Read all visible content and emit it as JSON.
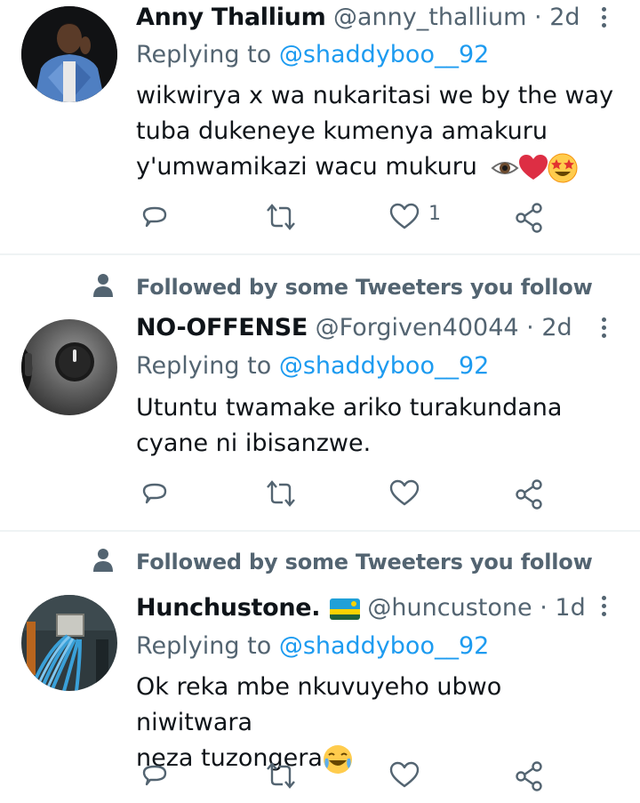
{
  "tweets": [
    {
      "name": "Anny Thallium",
      "handle": "@anny_thallium",
      "separator": "·",
      "time": "2d",
      "replying_prefix": "Replying to",
      "replying_handle": "@shaddyboo__92",
      "lines": [
        "wikwirya x wa nukaritasi we by the way",
        "tuba dukeneye kumenya amakuru",
        "y'umwamikazi wacu mukuru"
      ],
      "like_count": "1"
    },
    {
      "social_context": "Followed by some Tweeters you follow",
      "name": "NO-OFFENSE",
      "handle": "@Forgiven40044",
      "separator": "·",
      "time": "2d",
      "replying_prefix": "Replying to",
      "replying_handle": "@shaddyboo__92",
      "lines": [
        "Utuntu twamake ariko turakundana",
        "cyane ni ibisanzwe."
      ]
    },
    {
      "social_context": "Followed by some Tweeters you follow",
      "name": "Hunchustone.",
      "handle": "@huncustone",
      "separator": "·",
      "time": "1d",
      "replying_prefix": "Replying to",
      "replying_handle": "@shaddyboo__92",
      "lines": [
        "Ok reka mbe nkuvuyeho ubwo niwitwara",
        "neza tuzongera"
      ]
    }
  ],
  "icons": [
    "reply-icon",
    "retweet-icon",
    "like-icon",
    "share-icon",
    "more-options-icon",
    "person-icon",
    "eye-emoji",
    "red-heart-emoji",
    "star-struck-emoji",
    "rwanda-flag-emoji",
    "joy-emoji"
  ],
  "colors": {
    "link": "#1d9bf0",
    "secondary_text": "#536471",
    "divider": "#eff3f4",
    "primary_text": "#0f1419"
  }
}
